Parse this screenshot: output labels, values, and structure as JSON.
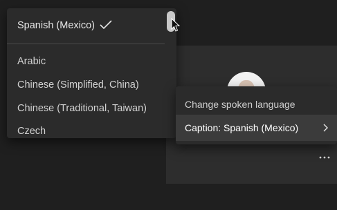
{
  "language_menu": {
    "selected_language": "Spanish (Mexico)",
    "items": [
      {
        "label": "Arabic"
      },
      {
        "label": "Chinese (Simplified, China)"
      },
      {
        "label": "Chinese (Traditional, Taiwan)"
      },
      {
        "label": "Czech"
      }
    ]
  },
  "caption_menu": {
    "change_spoken_label": "Change spoken language",
    "caption_label": "Caption: Spanish (Mexico)"
  },
  "colors": {
    "background": "#1f1f1f",
    "menu_background": "#2b2b2b",
    "highlight": "#3b3b3b",
    "text": "#e6e6e6"
  },
  "icons": [
    "check-icon",
    "chevron-right-icon",
    "more-options-icon",
    "mouse-cursor-icon",
    "avatar"
  ]
}
